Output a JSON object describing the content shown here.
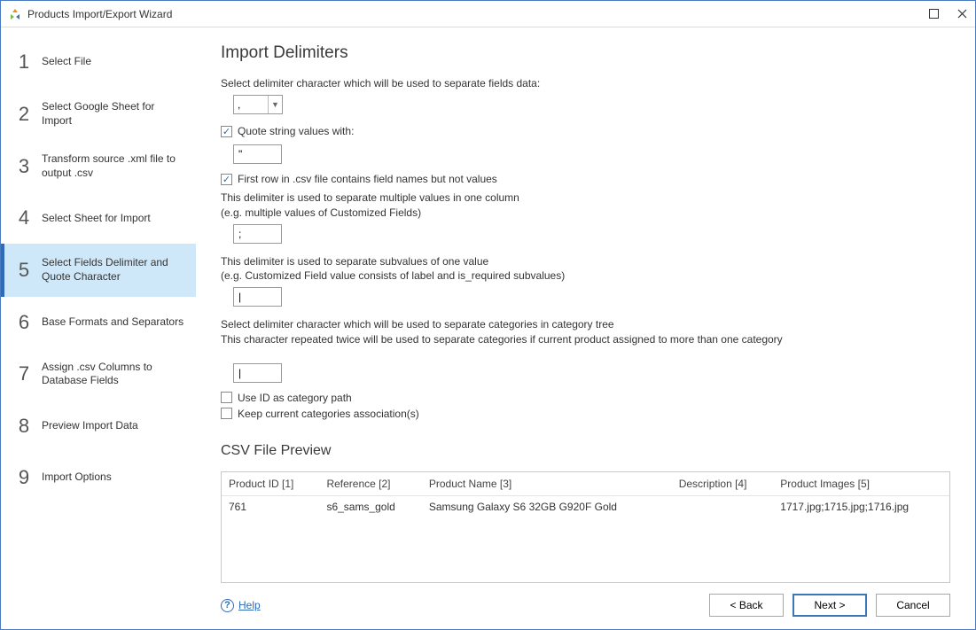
{
  "window": {
    "title": "Products Import/Export Wizard"
  },
  "sidebar": {
    "steps": [
      {
        "num": "1",
        "label": "Select File",
        "active": false
      },
      {
        "num": "2",
        "label": "Select Google Sheet for Import",
        "active": false
      },
      {
        "num": "3",
        "label": "Transform source .xml file to output .csv",
        "active": false
      },
      {
        "num": "4",
        "label": "Select Sheet for Import",
        "active": false
      },
      {
        "num": "5",
        "label": "Select Fields Delimiter and Quote Character",
        "active": true
      },
      {
        "num": "6",
        "label": "Base Formats and Separators",
        "active": false
      },
      {
        "num": "7",
        "label": "Assign .csv Columns to Database Fields",
        "active": false
      },
      {
        "num": "8",
        "label": "Preview Import Data",
        "active": false
      },
      {
        "num": "9",
        "label": "Import Options",
        "active": false
      }
    ]
  },
  "page": {
    "heading": "Import Delimiters",
    "delimiter_label": "Select delimiter character which will be used to separate fields data:",
    "delimiter_value": ",",
    "quote_check_label": "Quote string values with:",
    "quote_checked": true,
    "quote_value": "\"",
    "firstrow_label": "First row in .csv file contains field names but not values",
    "firstrow_checked": true,
    "multidelim_hint1": "This delimiter is used to separate multiple values in one column",
    "multidelim_hint2": "(e.g. multiple values of Customized Fields)",
    "multidelim_value": ";",
    "subval_hint1": "This delimiter is used to separate subvalues of one value",
    "subval_hint2": "(e.g. Customized Field value consists of label and is_required subvalues)",
    "subval_value": "|",
    "cat_hint1": "Select delimiter character which will be used to separate categories in category tree",
    "cat_hint2": "This character repeated twice will be used to separate categories if current product assigned to more than one category",
    "cat_value": "|",
    "useid_label": "Use ID as category path",
    "useid_checked": false,
    "keepcat_label": "Keep current categories association(s)",
    "keepcat_checked": false,
    "preview_heading": "CSV File Preview",
    "columns": [
      "Product ID [1]",
      "Reference [2]",
      "Product Name [3]",
      "Description [4]",
      "Product Images [5]"
    ],
    "rows": [
      {
        "c0": "761",
        "c1": "s6_sams_gold",
        "c2": "Samsung Galaxy S6 32GB G920F Gold",
        "c3": "",
        "c4": "1717.jpg;1715.jpg;1716.jpg"
      }
    ]
  },
  "footer": {
    "help": "Help",
    "back": "< Back",
    "next": "Next >",
    "cancel": "Cancel"
  }
}
